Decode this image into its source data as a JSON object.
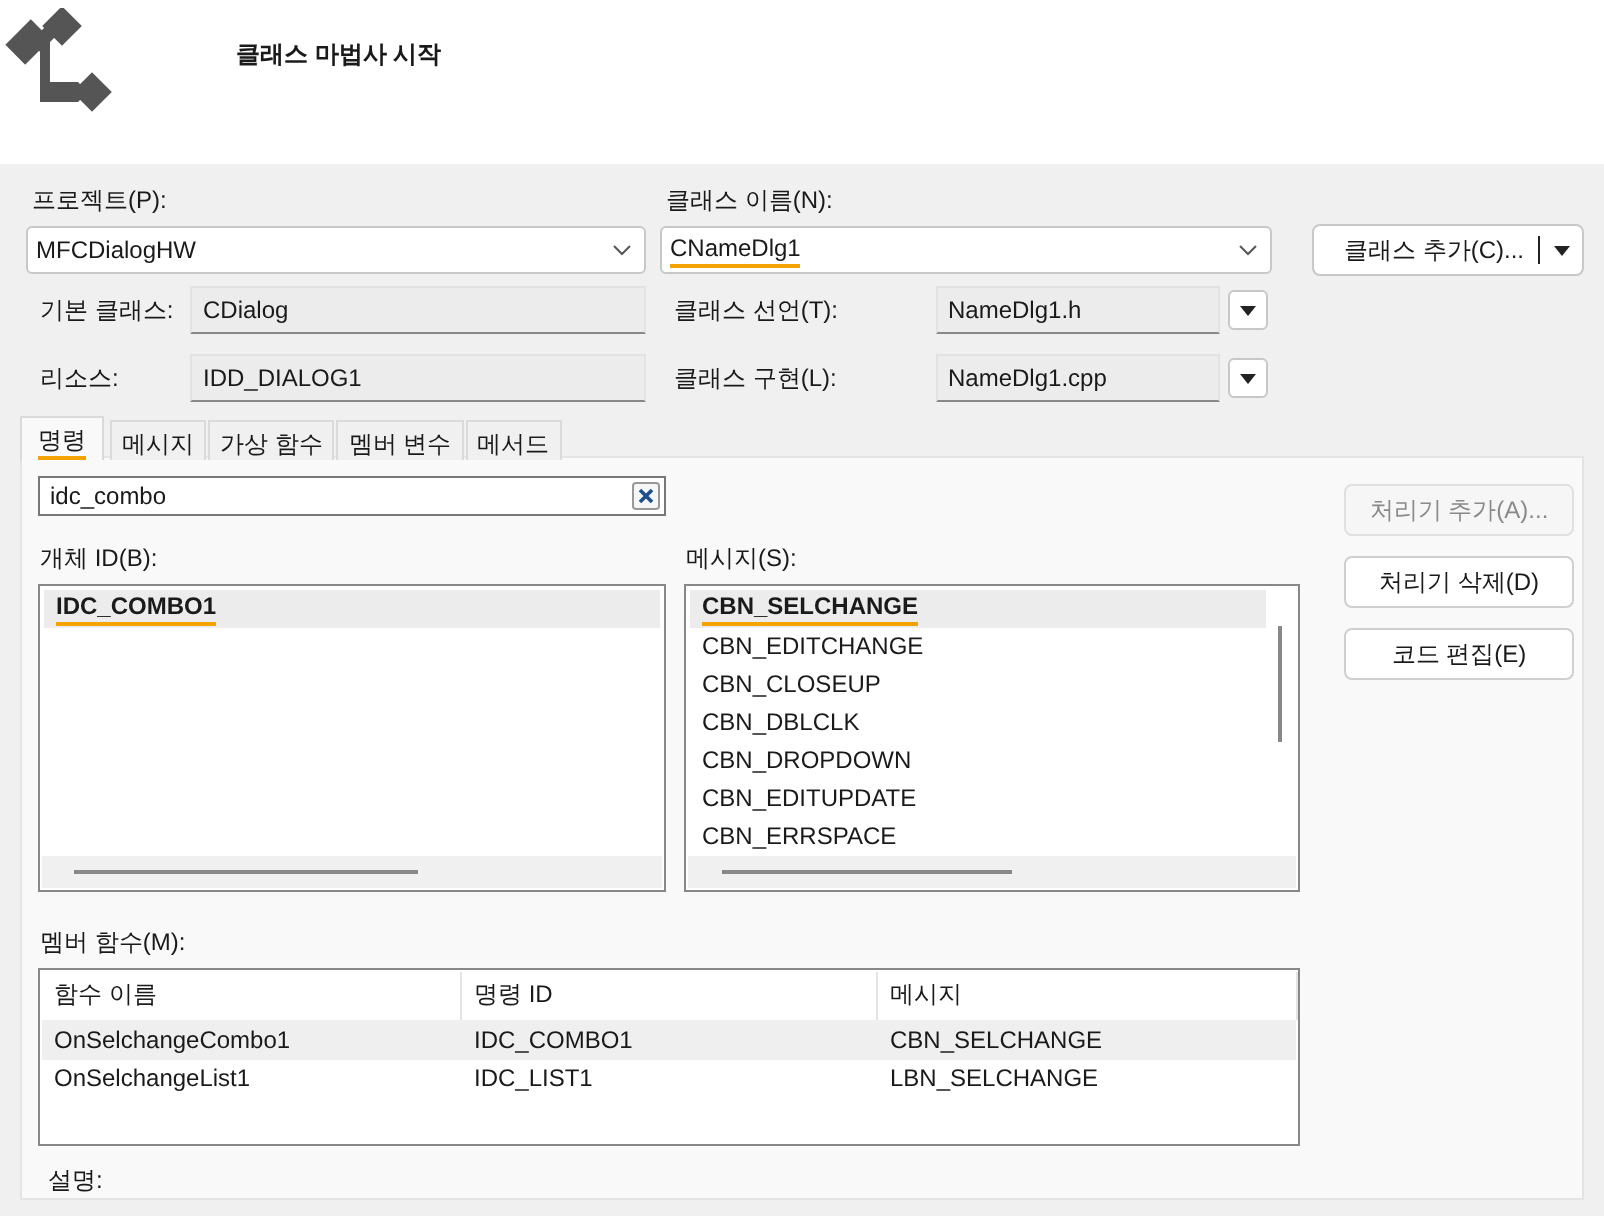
{
  "header": {
    "title": "클래스 마법사 시작"
  },
  "project": {
    "label": "프로젝트(P):",
    "value": "MFCDialogHW"
  },
  "class_name": {
    "label": "클래스 이름(N):",
    "value": "CNameDlg1",
    "underlined": true
  },
  "add_class_button": {
    "label": "클래스 추가(C)..."
  },
  "base_class": {
    "label": "기본 클래스:",
    "value": "CDialog"
  },
  "class_declaration": {
    "label": "클래스 선언(T):",
    "value": "NameDlg1.h"
  },
  "resource": {
    "label": "리소스:",
    "value": "IDD_DIALOG1"
  },
  "class_implementation": {
    "label": "클래스 구현(L):",
    "value": "NameDlg1.cpp"
  },
  "tabs": [
    {
      "label": "명령",
      "selected": true,
      "underlined": true
    },
    {
      "label": "메시지",
      "selected": false,
      "underlined": false
    },
    {
      "label": "가상 함수",
      "selected": false,
      "underlined": false
    },
    {
      "label": "멤버 변수",
      "selected": false,
      "underlined": false
    },
    {
      "label": "메서드",
      "selected": false,
      "underlined": false
    }
  ],
  "search": {
    "value": "idc_combo"
  },
  "object_ids": {
    "label": "개체 ID(B):",
    "items": [
      {
        "text": "IDC_COMBO1",
        "selected": true,
        "underlined": true
      }
    ]
  },
  "messages": {
    "label": "메시지(S):",
    "items": [
      {
        "text": "CBN_SELCHANGE",
        "selected": true,
        "underlined": true
      },
      {
        "text": "CBN_EDITCHANGE",
        "selected": false,
        "underlined": false
      },
      {
        "text": "CBN_CLOSEUP",
        "selected": false,
        "underlined": false
      },
      {
        "text": "CBN_DBLCLK",
        "selected": false,
        "underlined": false
      },
      {
        "text": "CBN_DROPDOWN",
        "selected": false,
        "underlined": false
      },
      {
        "text": "CBN_EDITUPDATE",
        "selected": false,
        "underlined": false
      },
      {
        "text": "CBN_ERRSPACE",
        "selected": false,
        "underlined": false
      }
    ]
  },
  "buttons": [
    {
      "label": "처리기 추가(A)...",
      "disabled": true
    },
    {
      "label": "처리기 삭제(D)",
      "disabled": false
    },
    {
      "label": "코드 편집(E)",
      "disabled": false
    }
  ],
  "member_functions": {
    "label": "멤버 함수(M):",
    "columns": [
      "함수 이름",
      "명령 ID",
      "메시지"
    ],
    "rows": [
      {
        "cells": [
          "OnSelchangeCombo1",
          "IDC_COMBO1",
          "CBN_SELCHANGE"
        ],
        "selected": true
      },
      {
        "cells": [
          "OnSelchangeList1",
          "IDC_LIST1",
          "LBN_SELCHANGE"
        ],
        "selected": false
      }
    ]
  },
  "description": {
    "label": "설명:"
  }
}
